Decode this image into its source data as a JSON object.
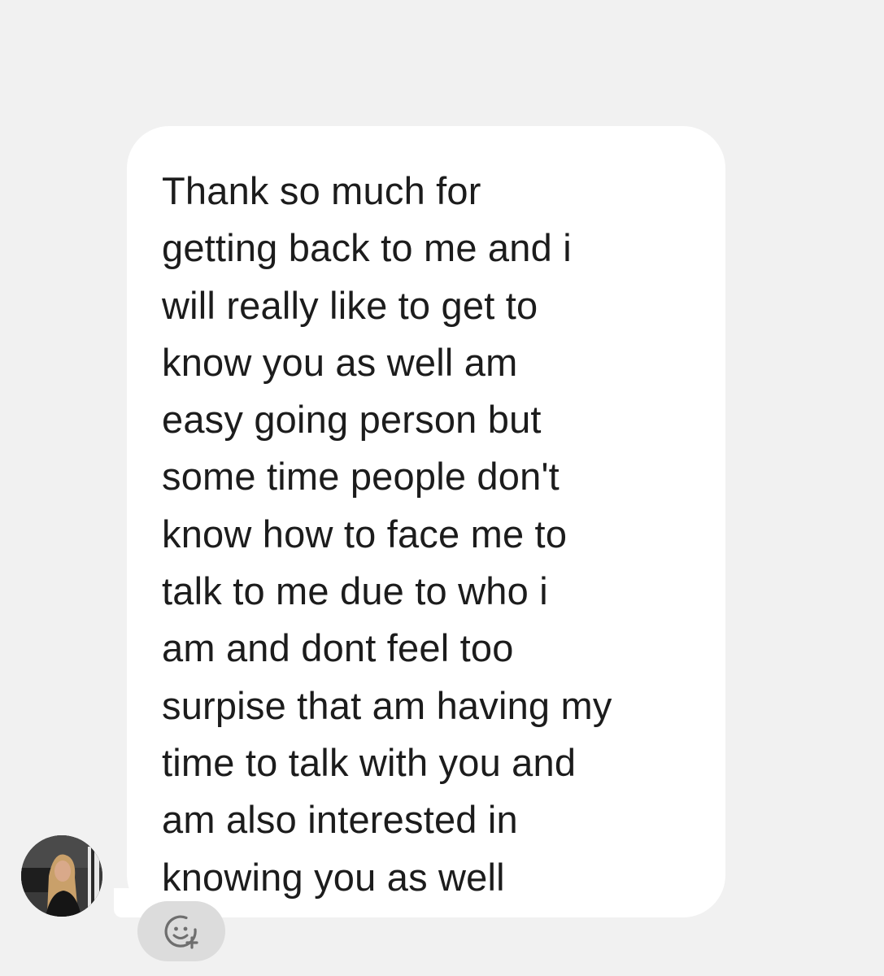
{
  "thread": {
    "message": {
      "text": "Thank so much for\ngetting back to me and i\nwill really like to get to\nknow you as well  am\neasy going person but\nsome time people don't\nknow how to face me to\ntalk to me  due to  who i\nam  and dont  feel too\nsurpise that am having my\ntime to talk with you and\nam also interested in\nknowing you as well"
    },
    "sender": {
      "avatar_icon": "profile-photo"
    },
    "reaction": {
      "icon": "add-reaction-icon"
    }
  },
  "colors": {
    "background": "#f1f1f1",
    "bubble": "#ffffff",
    "text": "#1c1c1c",
    "reaction_button": "#dcdcdc",
    "reaction_icon": "#6e6e6e"
  }
}
